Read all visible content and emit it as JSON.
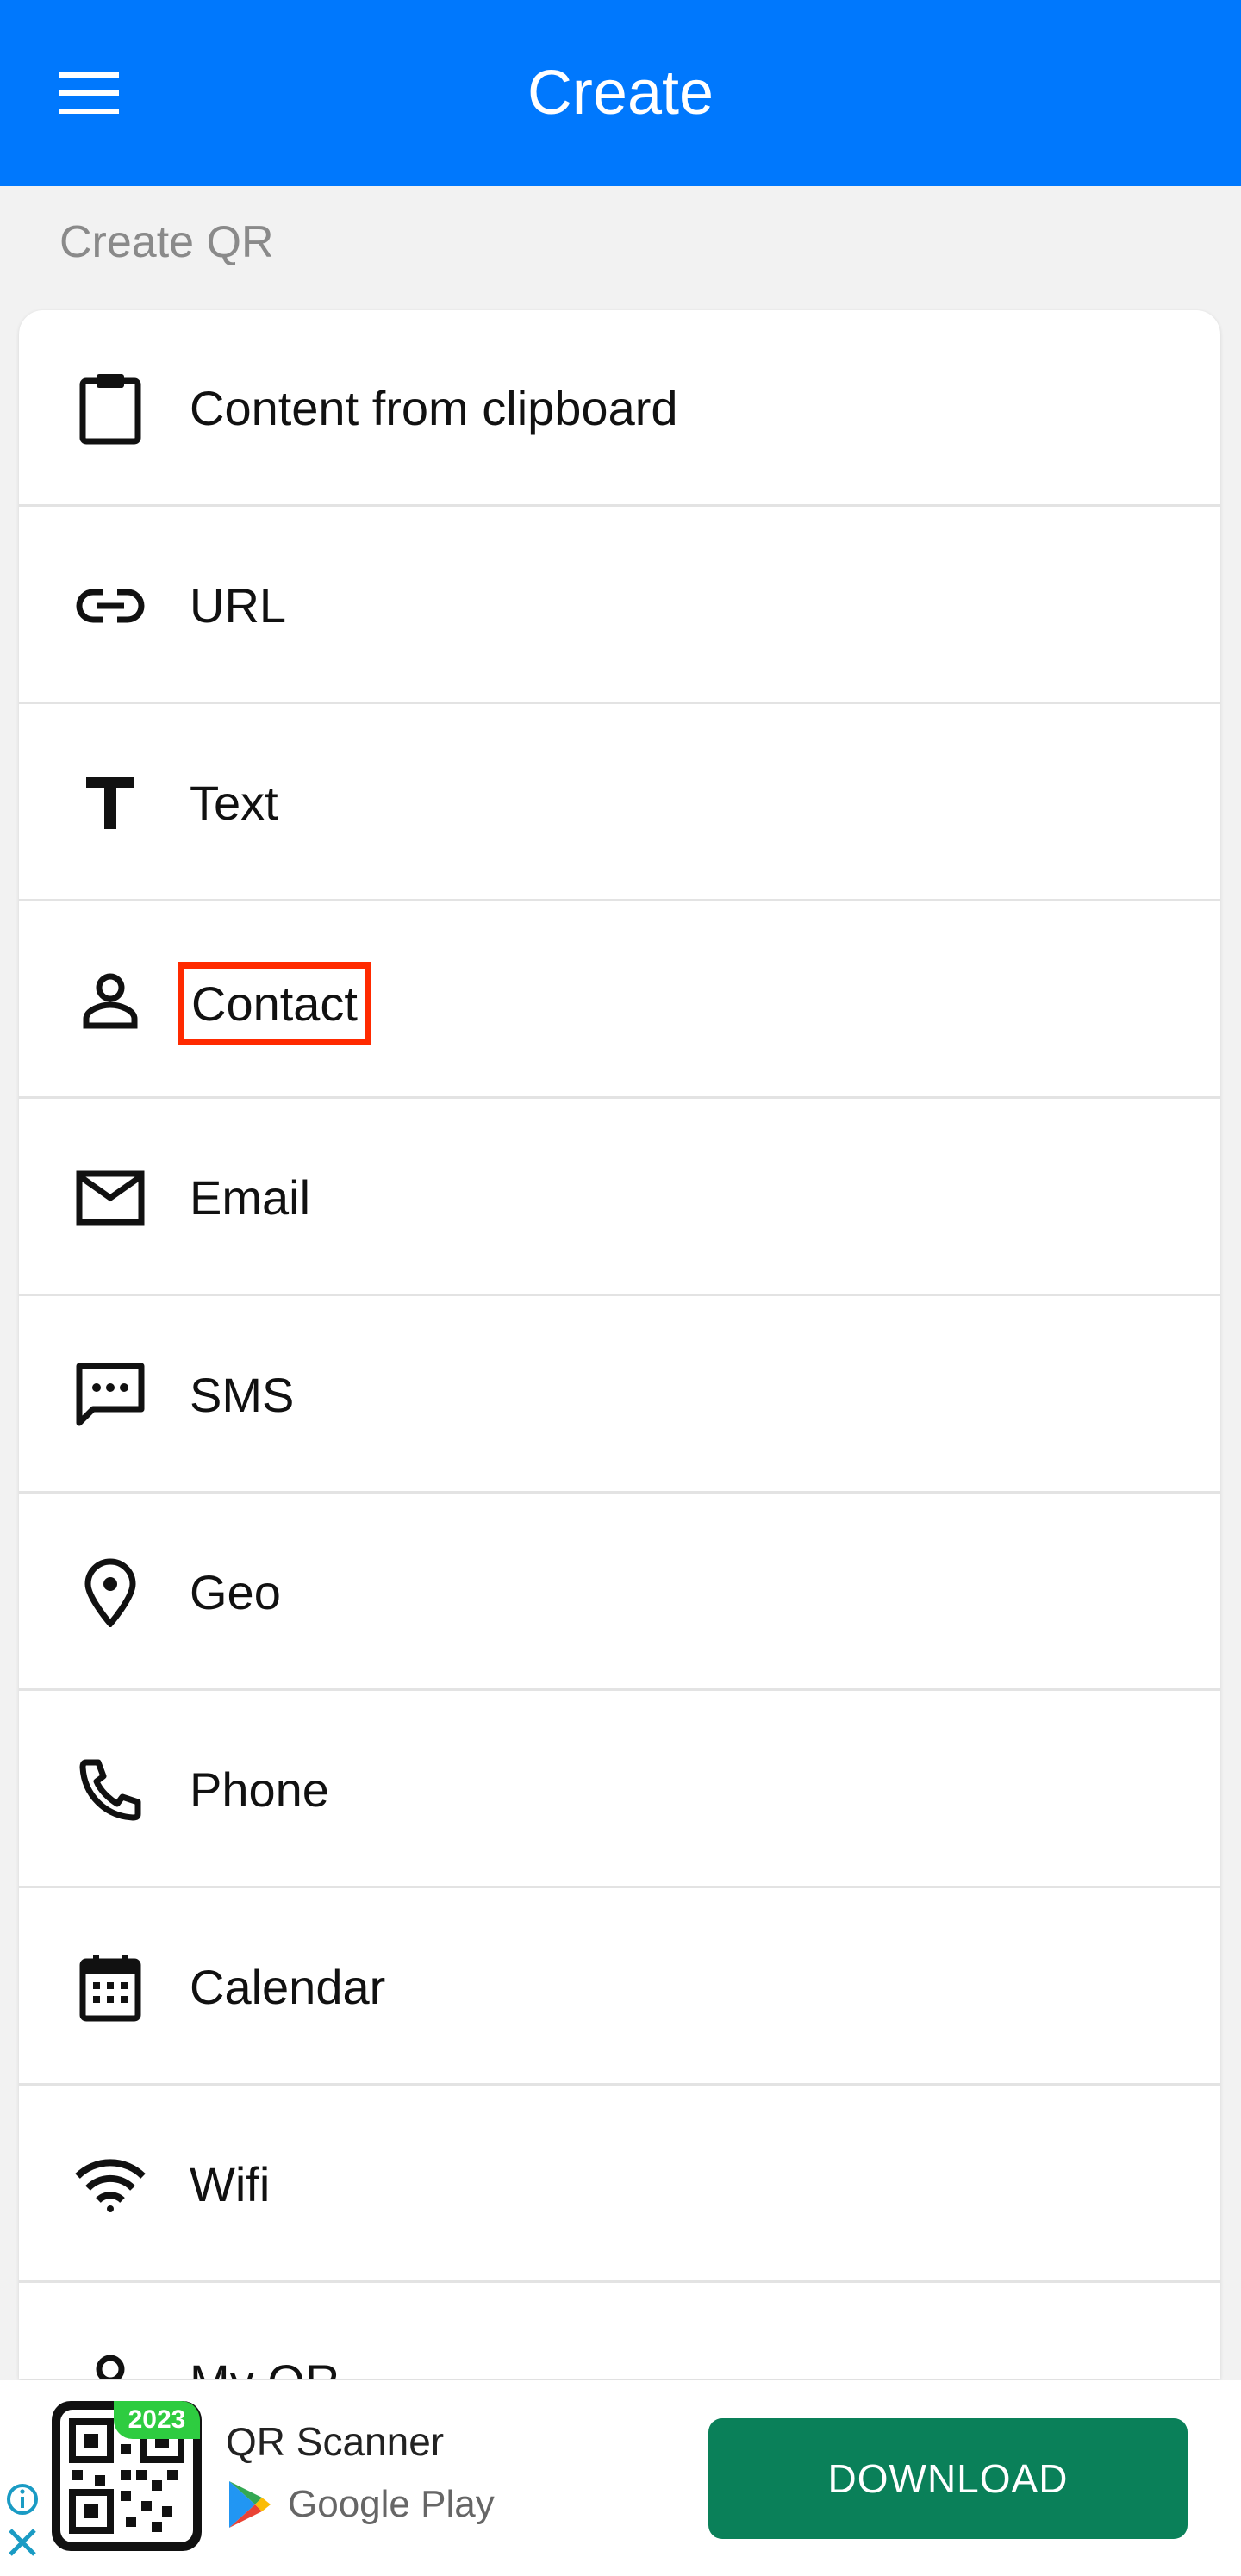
{
  "appbar": {
    "title": "Create"
  },
  "section_label": "Create QR",
  "items": [
    {
      "label": "Content from clipboard",
      "icon": "clipboard-icon"
    },
    {
      "label": "URL",
      "icon": "link-icon"
    },
    {
      "label": "Text",
      "icon": "text-icon"
    },
    {
      "label": "Contact",
      "icon": "person-icon"
    },
    {
      "label": "Email",
      "icon": "mail-icon"
    },
    {
      "label": "SMS",
      "icon": "message-icon"
    },
    {
      "label": "Geo",
      "icon": "location-pin-icon"
    },
    {
      "label": "Phone",
      "icon": "phone-icon"
    },
    {
      "label": "Calendar",
      "icon": "calendar-icon"
    },
    {
      "label": "Wifi",
      "icon": "wifi-icon"
    },
    {
      "label": "My QR",
      "icon": "person-icon"
    }
  ],
  "ad": {
    "badge": "2023",
    "app_name": "QR Scanner",
    "store_name": "Google Play",
    "download_label": "DOWNLOAD"
  },
  "colors": {
    "appbar": "#0078fd",
    "download": "#0a8059",
    "highlight": "#ff2a00"
  }
}
